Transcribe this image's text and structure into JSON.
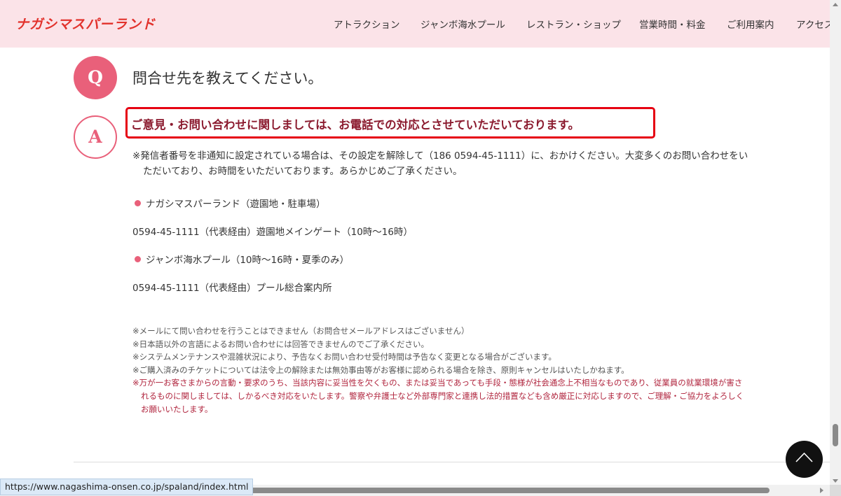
{
  "header": {
    "logo_text": "ナガシマスパーランド",
    "nav": [
      "アトラクション",
      "ジャンボ海水プール",
      "レストラン・ショップ",
      "営業時間・料金",
      "ご利用案内",
      "アクセス"
    ]
  },
  "faq": {
    "q_mark": "Q",
    "a_mark": "A",
    "question": "問合せ先を教えてください。",
    "answer_headline": "ご意見・お問い合わせに関しましては、お電話での対応とさせていただいております。",
    "note_line1": "※発信者番号を非通知に設定されている場合は、その設定を解除して（186 0594-45-1111）に、おかけください。大変多くのお問い合わせをい",
    "note_line2": "ただいており、お時間をいただいております。あらかじめご了承ください。",
    "contacts": [
      {
        "name": "ナガシマスパーランド（遊園地・駐車場）",
        "detail": "0594-45-1111（代表経由）遊園地メインゲート（10時〜16時）"
      },
      {
        "name": "ジャンボ海水プール（10時〜16時・夏季のみ）",
        "detail": "0594-45-1111（代表経由）プール総合案内所"
      }
    ],
    "small_notes": [
      "※メールにて問い合わせを行うことはできません（お問合せメールアドレスはございません）",
      "※日本語以外の言語によるお問い合わせには回答できませんのでご了承ください。",
      "※システムメンテナンスや混雑状況により、予告なくお問い合わせ受付時間は予告なく変更となる場合がございます。",
      "※ご購入済みのチケットについては法令上の解除または無効事由等がお客様に認められる場合を除き、原則キャンセルはいたしかねます。"
    ],
    "warning_lines": [
      "※万が一お客さまからの言動・要求のうち、当該内容に妥当性を欠くもの、または妥当であっても手段・態様が社会通念上不相当なものであり、従業員の就業環境が害さ",
      "れるものに関しましては、しかるべき対応をいたします。警察や弁護士など外部専門家と連携し法的措置なども含め厳正に対応しますので、ご理解・ご協力をよろしく",
      "お願いいたします。"
    ]
  },
  "status_bar": {
    "url": "https://www.nagashima-onsen.co.jp/spaland/index.html"
  },
  "icons": {
    "scroll_top": "chevron-up-icon"
  },
  "colors": {
    "header_bg": "#fbe3e8",
    "logo": "#e2322c",
    "accent_pink": "#e9607a",
    "highlight_border": "#e60012",
    "headline_text": "#8b1a2e",
    "warning_text": "#b0243d"
  }
}
